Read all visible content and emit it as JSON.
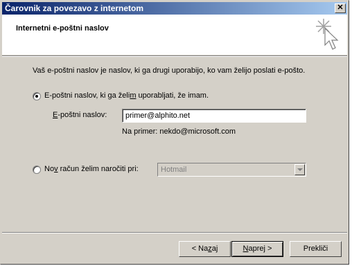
{
  "window": {
    "title": "Čarovnik za povezavo z internetom",
    "close_glyph": "✕"
  },
  "header": {
    "heading": "Internetni e-poštni naslov",
    "icon": "wizard-sparkle-cursor-icon"
  },
  "intro_text": "Vaš e-poštni naslov je naslov, ki ga drugi uporabijo, ko vam želijo poslati e-pošto.",
  "option_existing": {
    "label_before": "E-poštni naslov, ki ga želi",
    "label_accel": "m",
    "label_after": " uporabljati, že imam.",
    "selected": true
  },
  "email_field": {
    "label_accel": "E",
    "label_rest": "-poštni naslov:",
    "value": "primer@alphito.net",
    "example": "Na primer: nekdo@microsoft.com"
  },
  "option_new": {
    "label_before": "No",
    "label_accel": "v",
    "label_after": " račun želim naročiti pri:",
    "selected": false,
    "provider": "Hotmail"
  },
  "buttons": {
    "back": {
      "before": "< Na",
      "accel": "z",
      "after": "aj"
    },
    "next": {
      "accel": "N",
      "after": "aprej >"
    },
    "cancel": "Prekliči"
  }
}
